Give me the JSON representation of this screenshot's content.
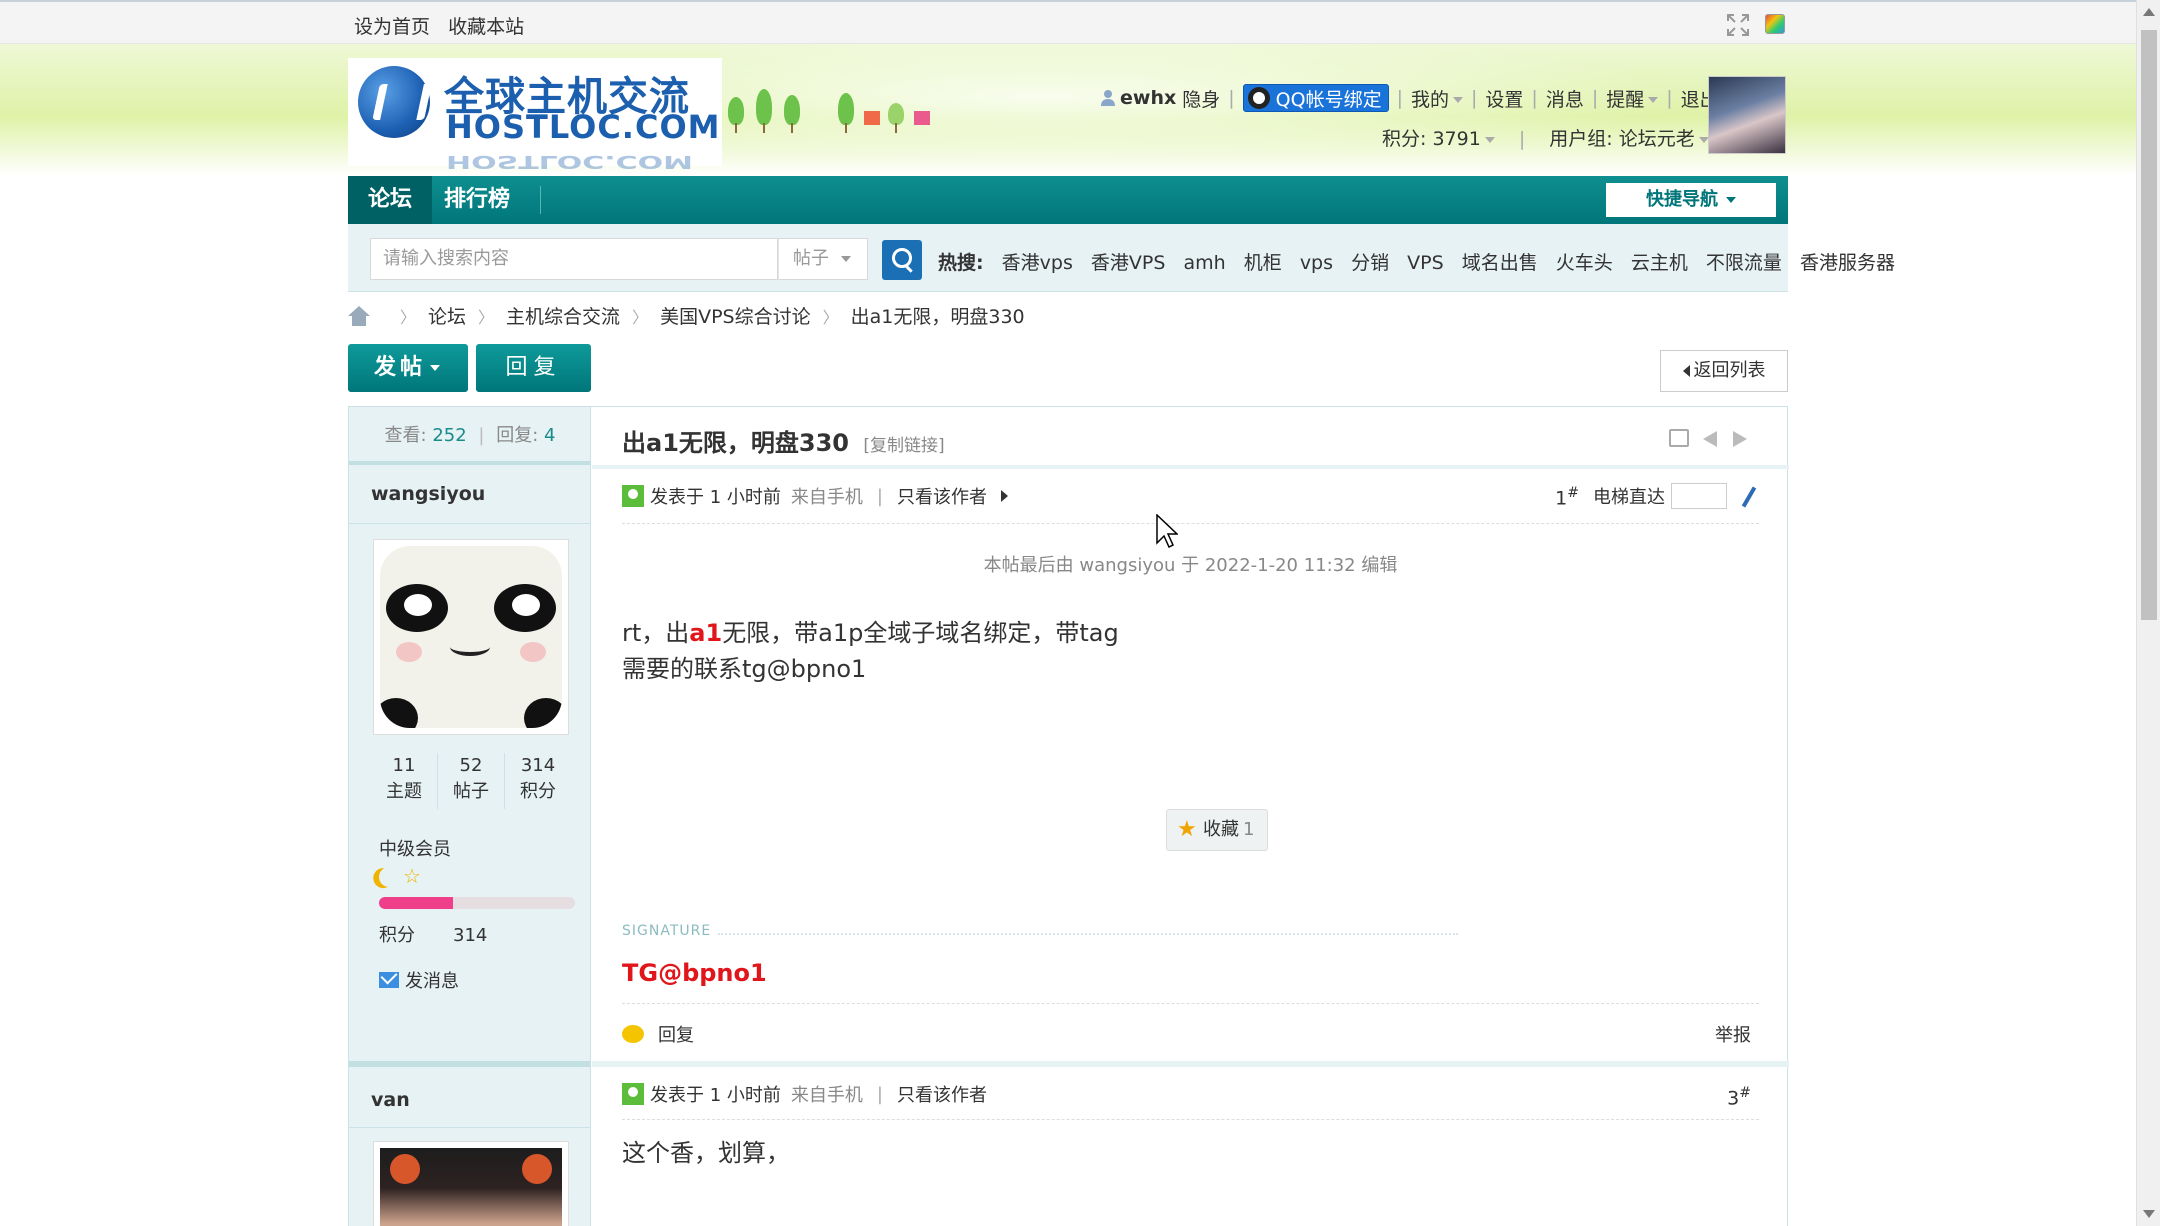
{
  "topbar": {
    "set_home": "设为首页",
    "bookmark": "收藏本站"
  },
  "logo": {
    "cn": "全球主机交流",
    "en": "HOSTLOC.COM"
  },
  "user": {
    "name": "ewhx",
    "invisible": "隐身",
    "qq_bind": "QQ帐号绑定",
    "mine": "我的",
    "settings": "设置",
    "messages": "消息",
    "reminders": "提醒",
    "logout": "退出",
    "credits": "积分: 3791",
    "group": "用户组: 论坛元老"
  },
  "nav": {
    "forum": "论坛",
    "ranking": "排行榜",
    "quick_nav": "快捷导航"
  },
  "search": {
    "placeholder": "请输入搜索内容",
    "type": "帖子",
    "hot_label": "热搜:",
    "hot": [
      "香港vps",
      "香港VPS",
      "amh",
      "机柜",
      "vps",
      "分销",
      "VPS",
      "域名出售",
      "火车头",
      "云主机",
      "不限流量",
      "香港服务器"
    ]
  },
  "breadcrumb": [
    "论坛",
    "主机综合交流",
    "美国VPS综合讨论",
    "出a1无限，明盘330"
  ],
  "actions": {
    "post": "发帖",
    "reply": "回复",
    "back": "返回列表"
  },
  "thread": {
    "views_label": "查看:",
    "views": "252",
    "replies_label": "回复:",
    "replies": "4",
    "title": "出a1无限，明盘330",
    "copy_link": "[复制链接]"
  },
  "posts": [
    {
      "author": "wangsiyou",
      "stats": [
        {
          "value": "11",
          "label": "主题"
        },
        {
          "value": "52",
          "label": "帖子"
        },
        {
          "value": "314",
          "label": "积分"
        }
      ],
      "level": "中级会员",
      "level_progress": 0.38,
      "credit_label": "积分",
      "credit": "314",
      "send_msg": "发消息",
      "posted": "发表于 1 小时前",
      "via": "来自手机",
      "only_author": "只看该作者",
      "floor": "1",
      "elevator": "电梯直达",
      "edit_note": "本帖最后由 wangsiyou 于 2022-1-20 11:32 编辑",
      "body_pre": "rt，出",
      "body_red": "a1",
      "body_post": "无限，带a1p全域子域名绑定，带tag",
      "body_line2": "需要的联系tg@bpno1",
      "fav_label": "收藏",
      "fav_count": "1",
      "sig_label": "SIGNATURE",
      "signature": "TG@bpno1",
      "reply": "回复",
      "report": "举报"
    },
    {
      "author": "van",
      "posted": "发表于 1 小时前",
      "via": "来自手机",
      "only_author": "只看该作者",
      "floor": "3",
      "body": "这个香，划算，"
    }
  ],
  "colors": {
    "nav_bg": "#00767a",
    "accent_red": "#e0161b",
    "link_teal": "#1a8a8a",
    "side_bg": "#e7f2f4"
  }
}
